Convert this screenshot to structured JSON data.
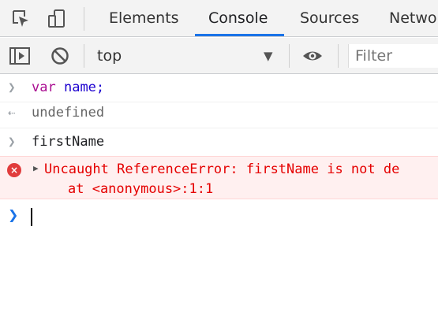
{
  "tabs": [
    {
      "label": "Elements",
      "active": false
    },
    {
      "label": "Console",
      "active": true
    },
    {
      "label": "Sources",
      "active": false
    },
    {
      "label": "Netwo",
      "active": false
    }
  ],
  "toolbar_icons": [
    "inspect-element-icon",
    "device-toggle-icon"
  ],
  "console_toolbar": {
    "context": "top",
    "filter_placeholder": "Filter",
    "icons": [
      "sidebar-toggle-icon",
      "clear-console-icon",
      "dropdown-caret-icon",
      "eye-icon"
    ]
  },
  "console": {
    "input1_keyword": "var",
    "input1_name": "name;",
    "output1": "undefined",
    "input2": "firstName",
    "error_line1": "Uncaught ReferenceError: firstName is not de",
    "error_line2": "at <anonymous>:1:1",
    "error_icon_text": "×"
  },
  "colors": {
    "accent": "#1a73e8",
    "error_text": "#e50000",
    "error_bg": "#fff0f0",
    "keyword": "#aa0d91",
    "variable": "#1c00cf"
  }
}
